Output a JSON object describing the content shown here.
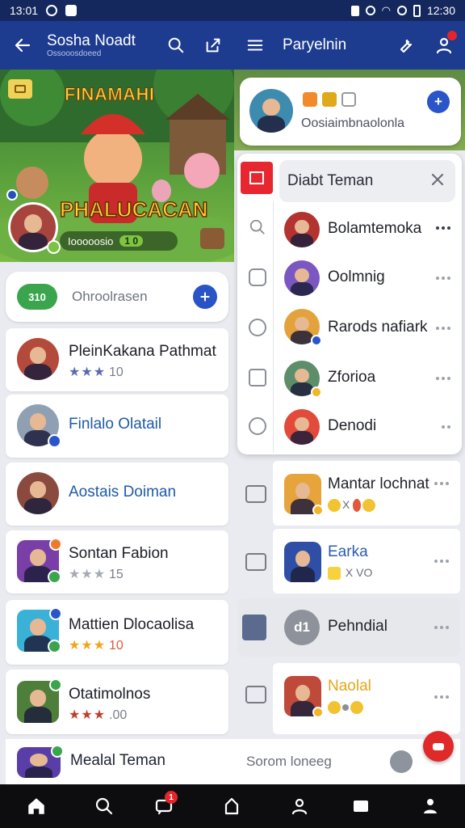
{
  "status_bar": {
    "time": "13:01",
    "battery_time": "12:30"
  },
  "header": {
    "title": "Sosha Noadt",
    "subtitle": "Ossooosdoeed",
    "right_title": "Paryelnin"
  },
  "banner": {
    "title": "FINAMAHI",
    "big_text": "PHALUCACAN",
    "footer_label": "Iooooosio",
    "footer_count": "1 0"
  },
  "search_pill": {
    "icon_text": "310",
    "placeholder": "Ohroolrasen"
  },
  "friends": [
    {
      "name": "PleinKakana Pathmat",
      "stars": "★★★",
      "rating": "10",
      "name_style": ""
    },
    {
      "name": "Finlalo Olatail",
      "stars": "",
      "rating": "",
      "name_style": "blue"
    },
    {
      "name": "Aostais Doiman",
      "stars": "",
      "rating": "",
      "name_style": "blue"
    },
    {
      "name": "Sontan Fabion",
      "stars": "★★★",
      "rating": "15",
      "name_style": ""
    },
    {
      "name": "Mattien Dlocaolisa",
      "stars": "★★★",
      "rating": "10",
      "name_style": ""
    },
    {
      "name": "Otatimolnos",
      "stars": "★★★",
      "rating": ".00",
      "name_style": ""
    }
  ],
  "group_card": {
    "description": "Oosiaimbnaolonla"
  },
  "panel": {
    "title": "Diabt Teman",
    "members": [
      {
        "name": "Bolamtemoka"
      },
      {
        "name": "Oolmnig"
      },
      {
        "name": "Rarods nafiark"
      },
      {
        "name": "Zforioa"
      },
      {
        "name": "Denodi"
      }
    ]
  },
  "lower_list": [
    {
      "name": "Mantar lochnat",
      "meta": "X",
      "name_style": ""
    },
    {
      "name": "Earka",
      "meta": "X VO",
      "name_style": "blue"
    },
    {
      "name": "Pehndial",
      "meta": "",
      "name_style": ""
    },
    {
      "name": "Naolal",
      "meta": "",
      "name_style": "gold"
    }
  ],
  "bottom_row": {
    "name": "Mealal Teman",
    "status": "Sorom loneeg"
  },
  "nav": {
    "messages_badge": "1"
  },
  "colors": {
    "header": "#1d3b8f",
    "accent_blue": "#2854c6",
    "accent_red": "#e8262f",
    "star": "#5b6bb1",
    "star_gold": "#f2a41b"
  }
}
